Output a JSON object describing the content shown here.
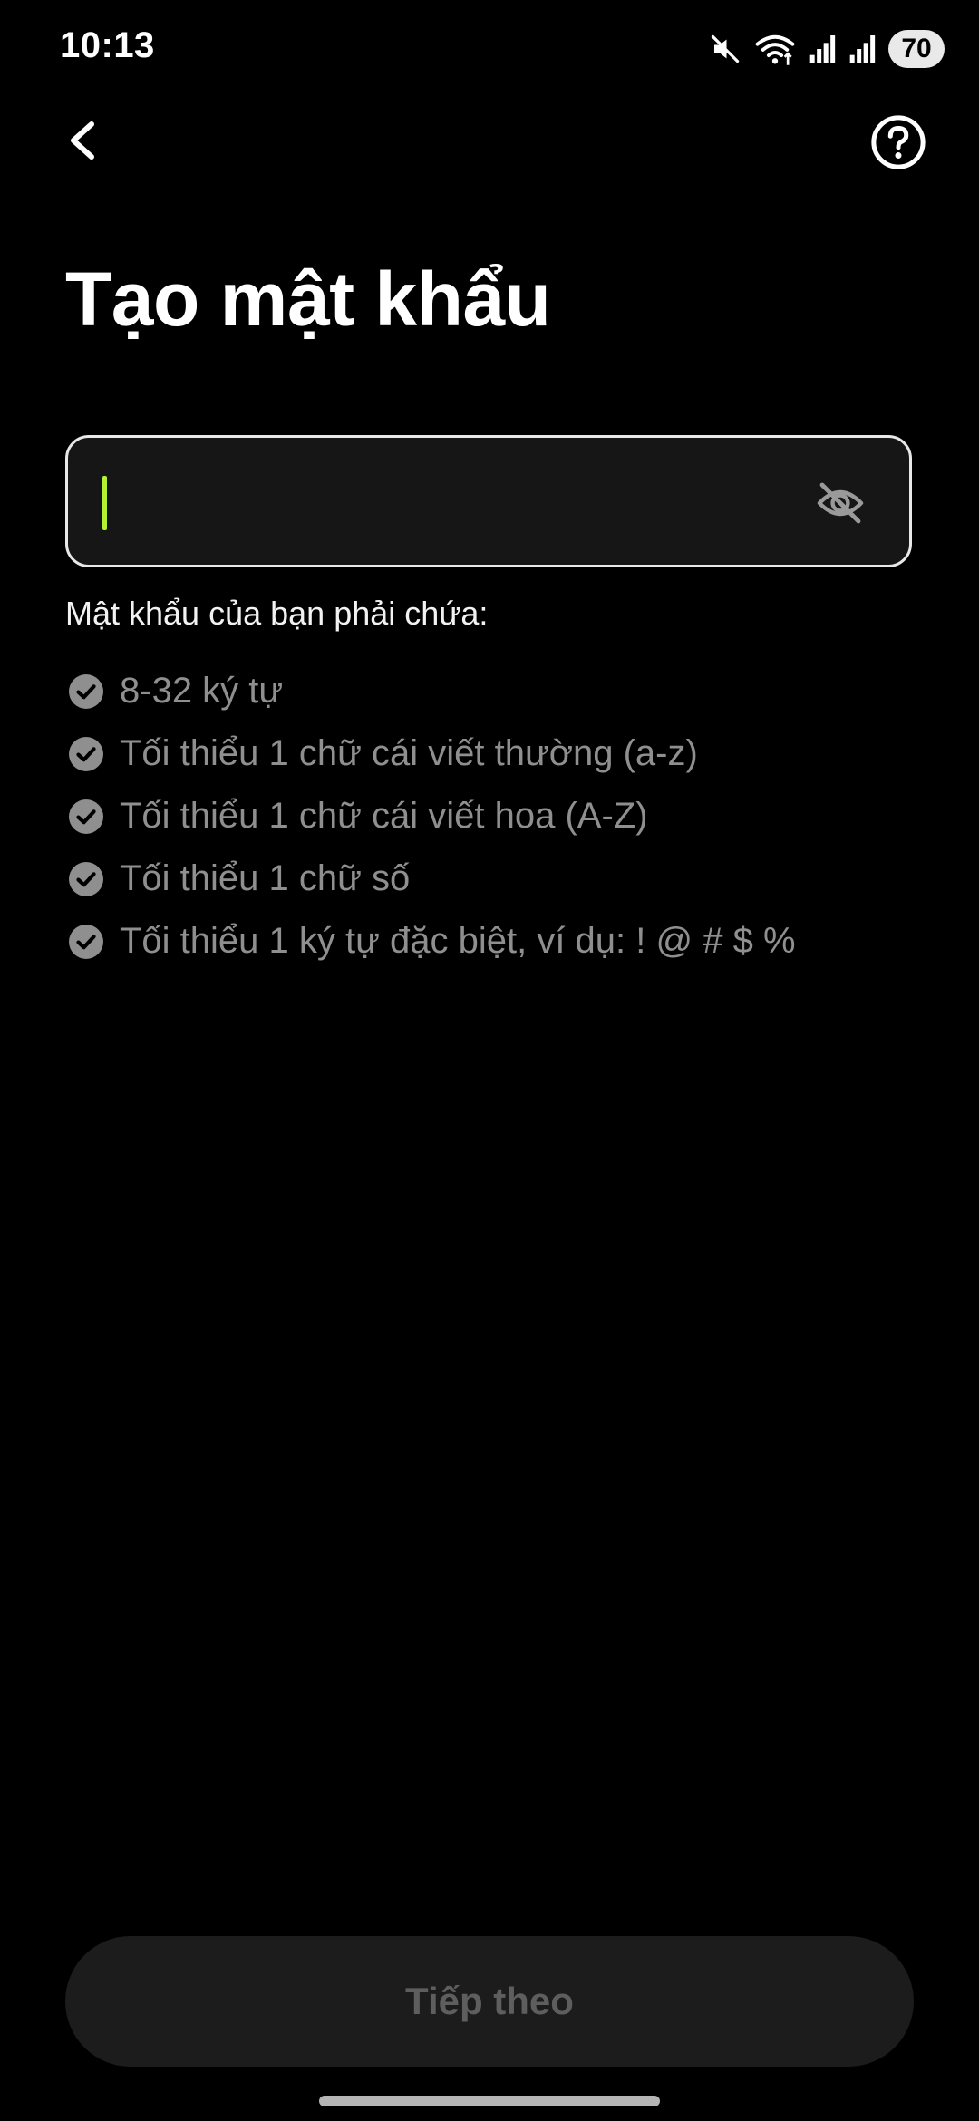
{
  "status_bar": {
    "time": "10:13",
    "battery": "70",
    "icons": [
      "mute-icon",
      "wifi-icon",
      "signal-icon",
      "signal-icon"
    ]
  },
  "nav": {
    "back_icon": "chevron-left-icon",
    "help_icon": "question-circle-icon"
  },
  "title": "Tạo mật khẩu",
  "password_field": {
    "value": "",
    "placeholder": "",
    "visibility_icon": "eye-off-icon"
  },
  "requirements": {
    "heading": "Mật khẩu của bạn phải chứa:",
    "items": [
      {
        "label": "8-32 ký tự",
        "met": false
      },
      {
        "label": "Tối thiểu 1 chữ cái viết thường (a-z)",
        "met": false
      },
      {
        "label": "Tối thiểu 1 chữ cái viết hoa (A-Z)",
        "met": false
      },
      {
        "label": "Tối thiểu 1 chữ số",
        "met": false
      },
      {
        "label": "Tối thiểu 1 ký tự đặc biệt, ví dụ: ! @ # $ %",
        "met": false
      }
    ]
  },
  "next_button": {
    "label": "Tiếp theo",
    "enabled": false
  },
  "colors": {
    "background": "#000000",
    "accent_caret": "#b6f234",
    "requirement_text": "#8f8f8f",
    "button_disabled_bg": "#1c1c1c",
    "button_disabled_text": "#5e5e5e"
  }
}
